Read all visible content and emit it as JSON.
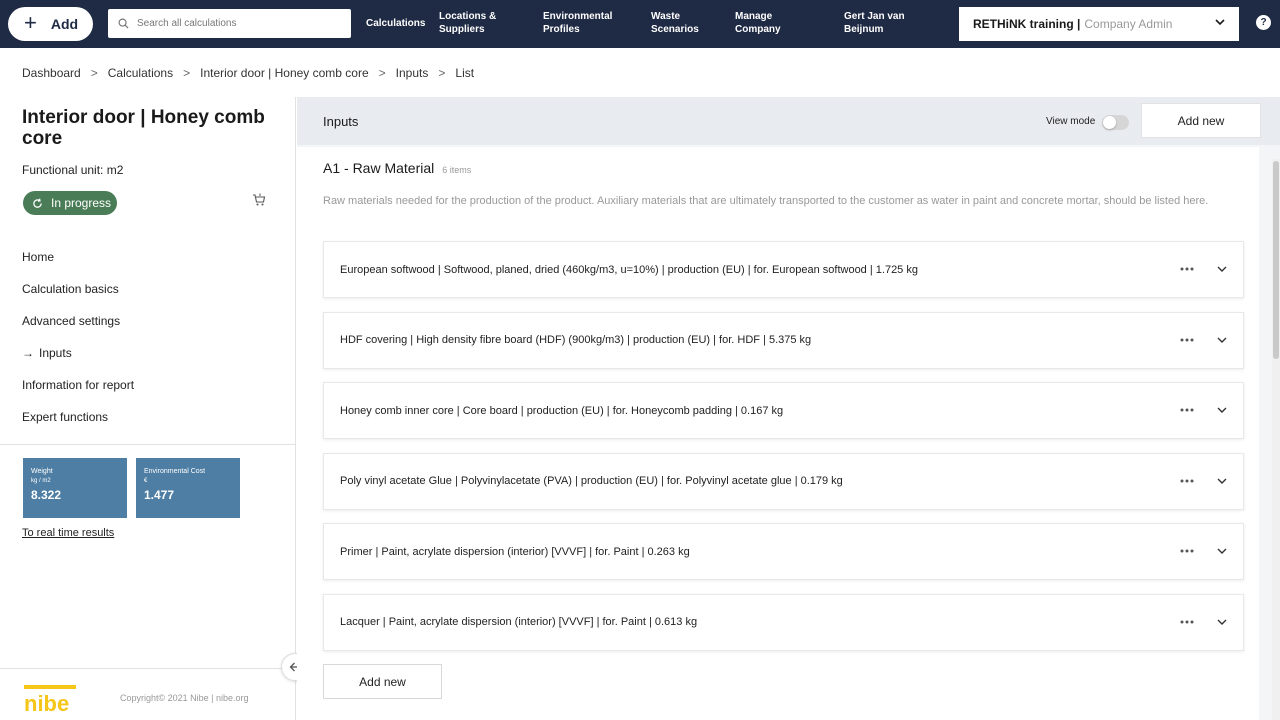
{
  "topbar": {
    "add_label": "Add",
    "search_placeholder": "Search all calculations",
    "nav": [
      {
        "label": "Calculations"
      },
      {
        "label": "Locations & Suppliers"
      },
      {
        "label": "Environmental Profiles"
      },
      {
        "label": "Waste Scenarios"
      },
      {
        "label": "Manage Company"
      },
      {
        "label": "Gert Jan van Beijnum"
      }
    ],
    "company": {
      "name": "RETHiNK training |",
      "role": "Company Admin"
    },
    "help_label": "?"
  },
  "breadcrumb": [
    "Dashboard",
    "Calculations",
    "Interior door | Honey comb core",
    "Inputs",
    "List"
  ],
  "breadcrumb_separator": ">",
  "sidebar": {
    "title": "Interior door | Honey comb core",
    "functional_unit": "Functional unit: m2",
    "status": "In progress",
    "nav": [
      {
        "label": "Home",
        "active": false
      },
      {
        "label": "Calculation basics",
        "active": false
      },
      {
        "label": "Advanced settings",
        "active": false
      },
      {
        "label": "Inputs",
        "active": true
      },
      {
        "label": "Information for report",
        "active": false
      },
      {
        "label": "Expert functions",
        "active": false
      }
    ],
    "active_marker": "→",
    "metrics": [
      {
        "label": "Weight",
        "unit": "kg / m2",
        "value": "8.322"
      },
      {
        "label": "Environmental Cost",
        "unit": "€",
        "value": "1.477"
      }
    ],
    "realtime_link": "To real time results",
    "logo_text": "nibe",
    "copyright": "Copyright© 2021 Nibe | nibe.org"
  },
  "main": {
    "title": "Inputs",
    "view_mode_label": "View mode",
    "view_mode_on": false,
    "add_new_label": "Add new",
    "section": {
      "title": "A1 - Raw Material",
      "count": "6 items",
      "description": "Raw materials needed for the production of the product. Auxiliary materials that are ultimately transported to the customer as water in paint and concrete mortar, should be listed here."
    },
    "items": [
      {
        "text": "European softwood | Softwood, planed, dried (460kg/m3, u=10%) | production (EU) | for. European softwood | 1.725 kg"
      },
      {
        "text": "HDF covering | High density fibre board (HDF) (900kg/m3) | production (EU) | for. HDF | 5.375 kg"
      },
      {
        "text": "Honey comb inner core | Core board | production (EU) | for. Honeycomb padding | 0.167 kg"
      },
      {
        "text": "Poly vinyl acetate Glue | Polyvinylacetate (PVA) | production (EU) | for. Polyvinyl acetate glue | 0.179 kg"
      },
      {
        "text": "Primer | Paint, acrylate dispersion (interior) [VVVF] | for. Paint | 0.263 kg"
      },
      {
        "text": "Lacquer | Paint, acrylate dispersion (interior) [VVVF] | for. Paint | 0.613 kg"
      }
    ],
    "add_new_bottom_label": "Add new"
  },
  "colors": {
    "topbar": "#1f2a44",
    "status_badge": "#4a7d57",
    "metric_card": "#4e7ea3",
    "logo": "#f5c518"
  }
}
